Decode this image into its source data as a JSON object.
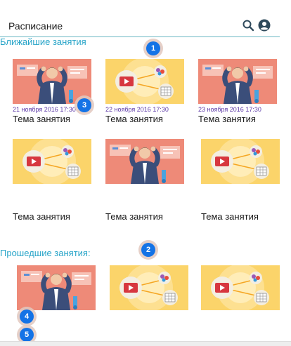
{
  "header": {
    "title": "Расписание",
    "search_icon": "search-icon",
    "account_icon": "account-icon"
  },
  "upcoming": {
    "title": "Ближайшие занятия",
    "cards": [
      {
        "type": "person",
        "date": "21 ноября 2016 17:30",
        "topic": "Тема занятия"
      },
      {
        "type": "video",
        "date": "22 ноября 2016 17:30",
        "topic": "Тема занятия"
      },
      {
        "type": "person",
        "date": "23 ноября 2016 17:30",
        "topic": "Тема занятия"
      },
      {
        "type": "video",
        "date": "",
        "topic": "Тема занятия"
      },
      {
        "type": "person",
        "date": "",
        "topic": "Тема занятия"
      },
      {
        "type": "video",
        "date": "",
        "topic": "Тема занятия"
      }
    ]
  },
  "past": {
    "title": "Прошедшие занятия:",
    "cards": [
      {
        "type": "person"
      },
      {
        "type": "video"
      },
      {
        "type": "video"
      }
    ]
  },
  "markers": [
    "1",
    "2",
    "3",
    "4",
    "5"
  ],
  "colors": {
    "accent": "#27a4c8",
    "date": "#5d3aa8",
    "marker": "#1473e6",
    "video_bg": "#fbd46a",
    "person_bg": "#ee8a78",
    "play": "#d7373f"
  }
}
